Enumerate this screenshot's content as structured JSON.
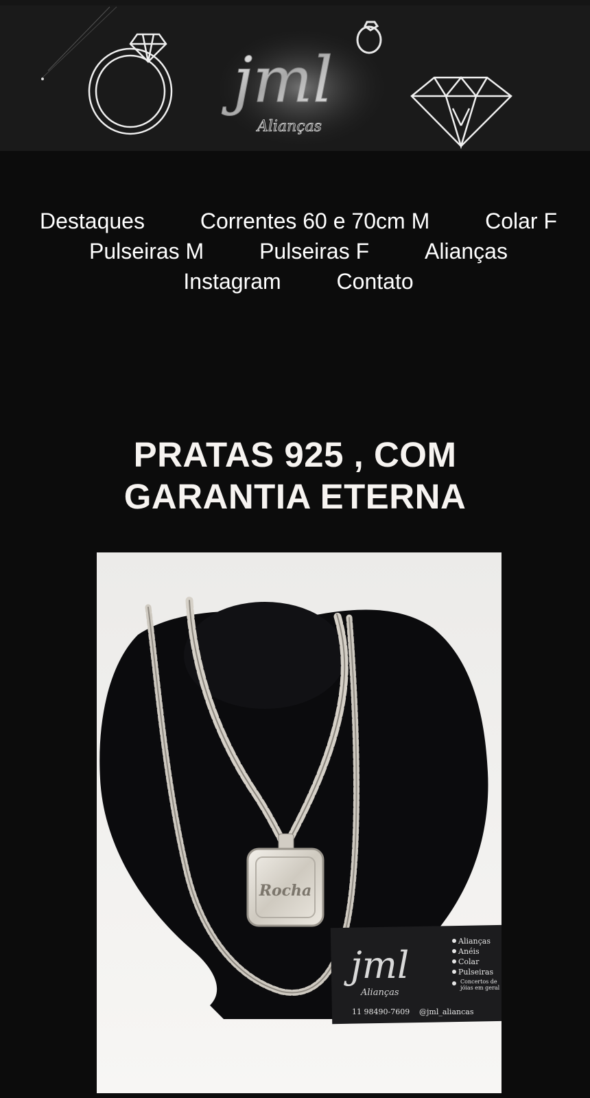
{
  "banner": {
    "logo_main": "jml",
    "logo_sub": "Alianças"
  },
  "nav": {
    "items": [
      {
        "label": "Destaques"
      },
      {
        "label": "Correntes 60 e 70cm M"
      },
      {
        "label": "Colar F"
      },
      {
        "label": "Pulseiras M"
      },
      {
        "label": "Pulseiras F"
      },
      {
        "label": "Alianças"
      },
      {
        "label": "Instagram"
      },
      {
        "label": "Contato"
      }
    ]
  },
  "headline": {
    "line1": "PRATAS 925 , COM",
    "line2": "GARANTIA ETERNA"
  },
  "product_photo": {
    "pendant_text": "Rocha",
    "card": {
      "logo_main": "jml",
      "logo_sub": "Alianças",
      "services": [
        "Alianças",
        "Anéis",
        "Colar",
        "Pulseiras",
        "Concertos de",
        "jóias em geral"
      ],
      "phone": "11 98490-7609",
      "instagram": "@jml_aliancas"
    }
  },
  "colors": {
    "page_background": "#0c0c0c",
    "banner_background": "#1a1a1a",
    "text": "#ffffff",
    "silver": "#c9c7c2"
  }
}
